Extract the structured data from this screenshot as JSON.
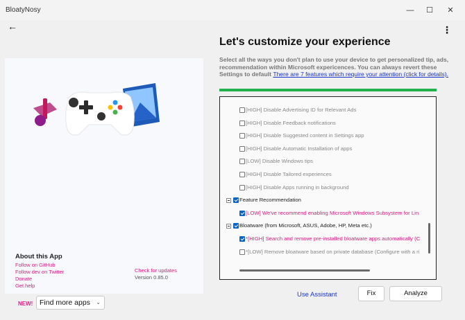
{
  "window": {
    "title": "BloatyNosy",
    "controls": {
      "minimize": "—",
      "maximize": "☐",
      "close": "✕"
    }
  },
  "nav": {
    "back_icon": "←",
    "menu_icon": "⋮"
  },
  "about": {
    "title": "About this App",
    "links": [
      "Follow on GitHub",
      "Follow dev on Twitter",
      "Donate",
      "Get help"
    ],
    "check_updates": "Check for updates",
    "version": "Version 0.85.0"
  },
  "bottom_left": {
    "new_badge": "NEW!",
    "find_apps_selected": "Find more apps",
    "chevron": "⌄"
  },
  "main": {
    "heading": "Let's customize your experience",
    "description": "Select all the ways you don't plan to use your device to get personalized tip, ads, recommendation within Microsoft expericences. You can always revert these Settings to default",
    "attention_link": "There are 7 features which require your attention (click for details).",
    "progress": 1.0,
    "progress_color": "#22b14c"
  },
  "features": [
    {
      "text": "[HIGH] Disable Advertising ID for Relevant Ads",
      "level": 1,
      "checked": false,
      "style": "grey"
    },
    {
      "text": "[HIGH] Disable Feedback notifications",
      "level": 1,
      "checked": false,
      "style": "grey"
    },
    {
      "text": "[HIGH] Disable Suggested content in Settings app",
      "level": 1,
      "checked": false,
      "style": "grey"
    },
    {
      "text": "[HIGH] Disable Automatic Installation of apps",
      "level": 1,
      "checked": false,
      "style": "grey"
    },
    {
      "text": "[LOW] Disable Windows tips",
      "level": 1,
      "checked": false,
      "style": "grey"
    },
    {
      "text": "[HIGH] Disable Tailored experiences",
      "level": 1,
      "checked": false,
      "style": "grey"
    },
    {
      "text": "[HIGH] Disable Apps running in background",
      "level": 1,
      "checked": false,
      "style": "grey"
    },
    {
      "text": "Feature Recommendation",
      "level": 0,
      "checked": true,
      "style": "dark"
    },
    {
      "text": "[LOW] We've recommend enabling Microsoft Windows Subsystem for Lin",
      "level": 1,
      "checked": true,
      "style": "pink"
    },
    {
      "text": "Bloatware (from Microsoft, ASUS, Adobe, HP, Meta etc.)",
      "level": 0,
      "checked": true,
      "style": "dark"
    },
    {
      "text": "*[HIGH] Search and remove pre-installed bloatware apps automatically (C",
      "level": 1,
      "checked": true,
      "style": "pink"
    },
    {
      "text": "*[LOW] Remove bloatware based on private database (Configure with a ri",
      "level": 1,
      "checked": false,
      "style": "grey"
    }
  ],
  "actions": {
    "use_assistant": "Use Assistant",
    "fix": "Fix",
    "analyze": "Analyze"
  },
  "colors": {
    "accent_pink": "#d62080",
    "link_blue": "#1a33cc",
    "checkbox_blue": "#0a63c7"
  }
}
